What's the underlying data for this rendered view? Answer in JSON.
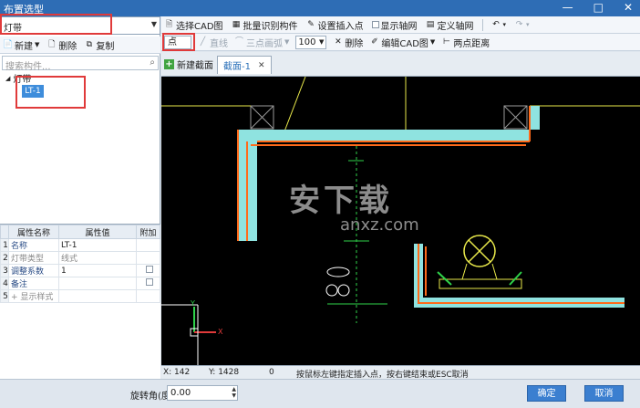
{
  "window": {
    "title": "布置选型",
    "minimize": "—",
    "maximize": "□",
    "close": "✕"
  },
  "left": {
    "type_select": "灯带",
    "toolbar": {
      "new": "新建",
      "delete": "删除",
      "copy": "复制"
    },
    "search_placeholder": "搜索构件...",
    "tree": {
      "root": "灯带",
      "selected_item": "LT-1"
    }
  },
  "props": {
    "headers": [
      "属性名称",
      "属性值",
      "附加"
    ],
    "rows": [
      {
        "num": "1",
        "name": "名称",
        "value": "LT-1"
      },
      {
        "num": "2",
        "name": "灯带类型",
        "value": "线式"
      },
      {
        "num": "3",
        "name": "调整系数",
        "value": "1"
      },
      {
        "num": "4",
        "name": "备注",
        "value": ""
      },
      {
        "num": "5",
        "name": "显示样式",
        "value": ""
      }
    ],
    "expand": "+"
  },
  "toolbar1": {
    "select_cad": "选择CAD图",
    "batch_identify": "批量识别构件",
    "set_insert_point": "设置插入点",
    "show_axis": "显示轴网",
    "define_axis": "定义轴网"
  },
  "toolbar2": {
    "point": "点",
    "line": "直线",
    "arc": "三点画弧",
    "zoom": "100",
    "delete": "删除",
    "edit_cad": "编辑CAD图",
    "point_distance": "两点距离"
  },
  "tabs": {
    "new_section": "新建截面",
    "active_tab": "截面-1"
  },
  "canvas": {
    "watermark_main": "安下载",
    "watermark_sub": "anxz.com",
    "axis_x": "X",
    "axis_y": "Y"
  },
  "status": {
    "x": "X: 142",
    "y": "Y: 1428",
    "value": "0",
    "hint": "按鼠标左键指定插入点，按右键结束或ESC取消"
  },
  "bottom": {
    "rotation_label": "旋转角(度):",
    "rotation_value": "0.00",
    "ok": "确定",
    "cancel": "取消"
  },
  "colors": {
    "title_bar": "#2e6db5",
    "wall_fill": "#8fe3e0",
    "wall_edge": "#ff6a1a",
    "cad_yellow": "#e8e84a",
    "cad_green": "#2fd24a",
    "highlight": "#e03a3a",
    "button": "#3b7fd0"
  }
}
